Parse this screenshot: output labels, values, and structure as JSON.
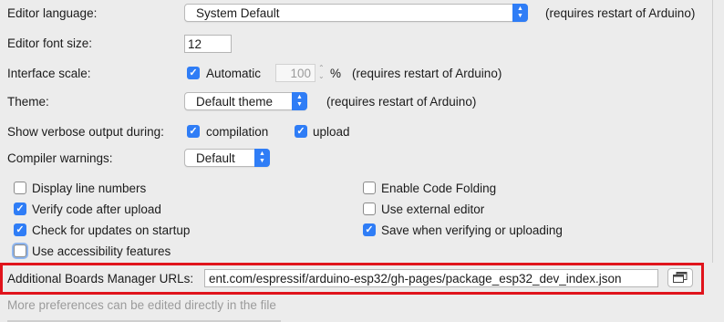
{
  "editor_language": {
    "label": "Editor language:",
    "value": "System Default",
    "note": "(requires restart of Arduino)"
  },
  "editor_font_size": {
    "label": "Editor font size:",
    "value": "12"
  },
  "interface_scale": {
    "label": "Interface scale:",
    "automatic_label": "Automatic",
    "value": "100",
    "unit": "%",
    "note": "(requires restart of Arduino)"
  },
  "theme": {
    "label": "Theme:",
    "value": "Default theme",
    "note": "(requires restart of Arduino)"
  },
  "verbose_output": {
    "label": "Show verbose output during:",
    "compilation_label": "compilation",
    "upload_label": "upload"
  },
  "compiler_warnings": {
    "label": "Compiler warnings:",
    "value": "Default"
  },
  "options": {
    "left": [
      {
        "label": "Display line numbers",
        "checked": false
      },
      {
        "label": "Verify code after upload",
        "checked": true
      },
      {
        "label": "Check for updates on startup",
        "checked": true
      },
      {
        "label": "Use accessibility features",
        "checked": false
      }
    ],
    "right": [
      {
        "label": "Enable Code Folding",
        "checked": false
      },
      {
        "label": "Use external editor",
        "checked": false
      },
      {
        "label": "Save when verifying or uploading",
        "checked": true
      }
    ]
  },
  "boards_urls": {
    "label": "Additional Boards Manager URLs:",
    "value": "ent.com/espressif/arduino-esp32/gh-pages/package_esp32_dev_index.json",
    "highlight_color": "#e0141c"
  },
  "footer": {
    "note": "More preferences can be edited directly in the file"
  },
  "colors": {
    "accent": "#2f7df6",
    "background": "#ececec"
  },
  "icons": {
    "select_stepper": "up-down-chevron-icon",
    "checkmark": "checkmark-icon",
    "url_editor": "window-icon"
  }
}
